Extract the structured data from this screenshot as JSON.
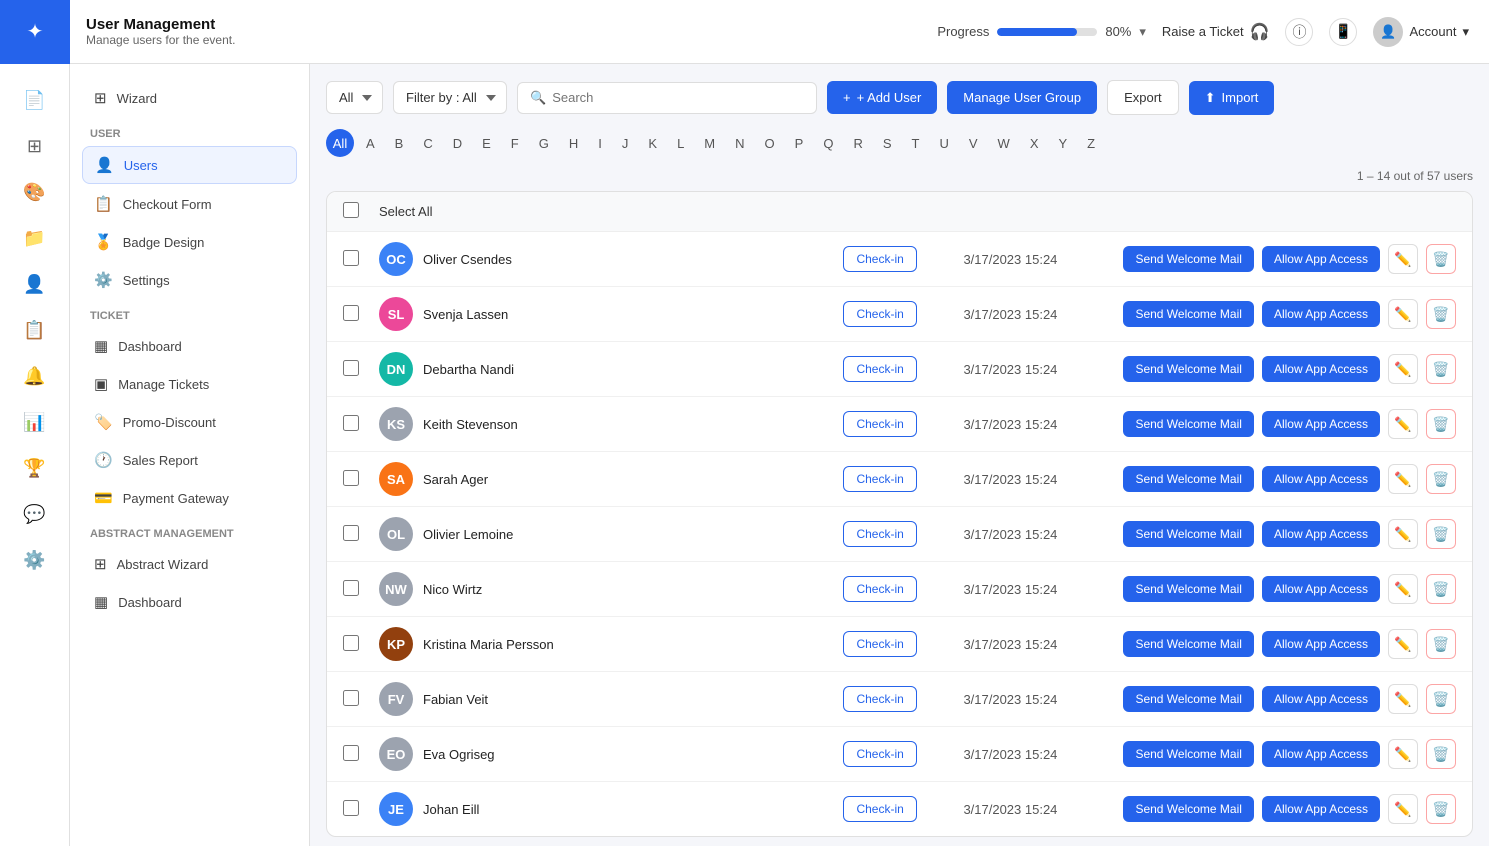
{
  "header": {
    "app_name": "User Management",
    "subtitle": "Manage users for the event.",
    "progress_label": "Progress",
    "progress_pct": 80,
    "progress_text": "80%",
    "raise_ticket": "Raise a Ticket",
    "account_label": "Account"
  },
  "toolbar": {
    "filter_all": "All",
    "filter_by": "Filter by : All",
    "search_placeholder": "Search",
    "add_user": "+ Add User",
    "manage_user_group": "Manage User Group",
    "export": "Export",
    "import": "Import"
  },
  "alphabet": [
    "All",
    "A",
    "B",
    "C",
    "D",
    "E",
    "F",
    "G",
    "H",
    "I",
    "J",
    "K",
    "L",
    "M",
    "N",
    "O",
    "P",
    "Q",
    "R",
    "S",
    "T",
    "U",
    "V",
    "W",
    "X",
    "Y",
    "Z"
  ],
  "table": {
    "select_all": "Select All",
    "count_text": "1 – 14 out of 57 users",
    "btn_checkin": "Check-in",
    "btn_send_mail": "Send Welcome Mail",
    "btn_allow_app": "Allow App Access",
    "users": [
      {
        "name": "Oliver Csendes",
        "date": "3/17/2023 15:24",
        "av_color": "av-blue",
        "initials": "OC"
      },
      {
        "name": "Svenja Lassen",
        "date": "3/17/2023 15:24",
        "av_color": "av-pink",
        "initials": "SL"
      },
      {
        "name": "Debartha Nandi",
        "date": "3/17/2023 15:24",
        "av_color": "av-teal",
        "initials": "DN"
      },
      {
        "name": "Keith Stevenson",
        "date": "3/17/2023 15:24",
        "av_color": "av-gray",
        "initials": "KS"
      },
      {
        "name": "Sarah Ager",
        "date": "3/17/2023 15:24",
        "av_color": "av-orange",
        "initials": "SA"
      },
      {
        "name": "Olivier Lemoine",
        "date": "3/17/2023 15:24",
        "av_color": "av-gray",
        "initials": "OL"
      },
      {
        "name": "Nico Wirtz",
        "date": "3/17/2023 15:24",
        "av_color": "av-gray",
        "initials": "NW"
      },
      {
        "name": "Kristina Maria Persson",
        "date": "3/17/2023 15:24",
        "av_color": "av-brown",
        "initials": "KP"
      },
      {
        "name": "Fabian Veit",
        "date": "3/17/2023 15:24",
        "av_color": "av-gray",
        "initials": "FV"
      },
      {
        "name": "Eva Ogriseg",
        "date": "3/17/2023 15:24",
        "av_color": "av-gray",
        "initials": "EO"
      },
      {
        "name": "Johan Eill",
        "date": "3/17/2023 15:24",
        "av_color": "av-blue",
        "initials": "JE"
      }
    ]
  },
  "sidebar": {
    "section_user": "User",
    "section_ticket": "Ticket",
    "section_abstract": "Abstract Management",
    "items_top": [
      {
        "id": "wizard",
        "label": "Wizard",
        "icon": "⊞"
      }
    ],
    "items_user": [
      {
        "id": "users",
        "label": "Users",
        "icon": "👤",
        "active": true
      },
      {
        "id": "checkout",
        "label": "Checkout Form",
        "icon": "📋"
      },
      {
        "id": "badge",
        "label": "Badge Design",
        "icon": "🏅"
      },
      {
        "id": "settings",
        "label": "Settings",
        "icon": "⚙️"
      }
    ],
    "items_ticket": [
      {
        "id": "dashboard",
        "label": "Dashboard",
        "icon": "▦"
      },
      {
        "id": "manage-tickets",
        "label": "Manage Tickets",
        "icon": "▣"
      },
      {
        "id": "promo",
        "label": "Promo-Discount",
        "icon": "🏷️"
      },
      {
        "id": "sales",
        "label": "Sales Report",
        "icon": "🕐"
      },
      {
        "id": "payment",
        "label": "Payment Gateway",
        "icon": "💳"
      }
    ],
    "items_abstract": [
      {
        "id": "abstract-wizard",
        "label": "Abstract Wizard",
        "icon": "⊞"
      },
      {
        "id": "abstract-dashboard",
        "label": "Dashboard",
        "icon": "▦"
      }
    ]
  },
  "rail_icons": [
    "📄",
    "⊞",
    "🎨",
    "📁",
    "👤",
    "📋",
    "🔔",
    "📊",
    "🏆",
    "💬",
    "⚙️"
  ]
}
